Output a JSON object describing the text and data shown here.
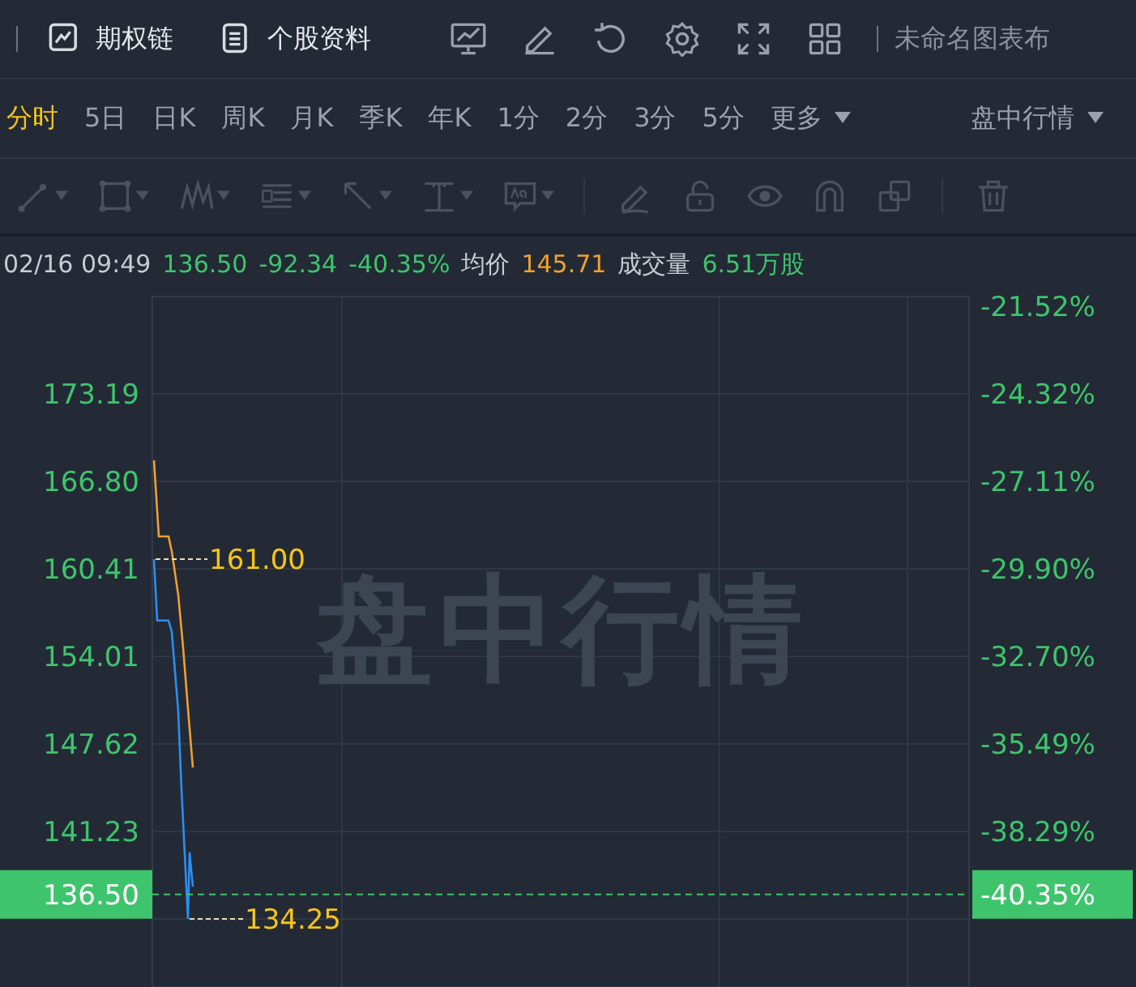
{
  "toolbar": {
    "links": [
      {
        "label": "期权链"
      },
      {
        "label": "个股资料"
      }
    ],
    "layout_name": "未命名图表布"
  },
  "periods": [
    {
      "label": "分时",
      "selected": true
    },
    {
      "label": "5日",
      "selected": false
    },
    {
      "label": "日K",
      "selected": false
    },
    {
      "label": "周K",
      "selected": false
    },
    {
      "label": "月K",
      "selected": false
    },
    {
      "label": "季K",
      "selected": false
    },
    {
      "label": "年K",
      "selected": false
    },
    {
      "label": "1分",
      "selected": false
    },
    {
      "label": "2分",
      "selected": false
    },
    {
      "label": "3分",
      "selected": false
    },
    {
      "label": "5分",
      "selected": false
    },
    {
      "label": "更多",
      "selected": false,
      "kind": "dropdown"
    }
  ],
  "session_dropdown": {
    "label": "盘中行情"
  },
  "quote": [
    {
      "text": "02/16 09:49",
      "color": "#c8ccd2"
    },
    {
      "text": "136.50",
      "color": "#3ec46d"
    },
    {
      "text": "-92.34",
      "color": "#3ec46d"
    },
    {
      "text": "-40.35%",
      "color": "#3ec46d"
    },
    {
      "text": "均价",
      "color": "#c8ccd2"
    },
    {
      "text": "145.71",
      "color": "#f0a030"
    },
    {
      "text": "成交量",
      "color": "#c8ccd2"
    },
    {
      "text": "6.51万股",
      "color": "#3ec46d"
    }
  ],
  "chart": {
    "watermark": "盘中行情",
    "current_price_badge": "136.50",
    "current_pct_badge": "-40.35%",
    "price_ticks": [
      "173.19",
      "166.80",
      "160.41",
      "154.01",
      "147.62",
      "141.23"
    ],
    "pct_ticks": [
      "-21.52%",
      "-24.32%",
      "-27.11%",
      "-29.90%",
      "-32.70%",
      "-35.49%",
      "-38.29%"
    ],
    "high_marker": "161.00",
    "low_marker": "134.25"
  }
}
